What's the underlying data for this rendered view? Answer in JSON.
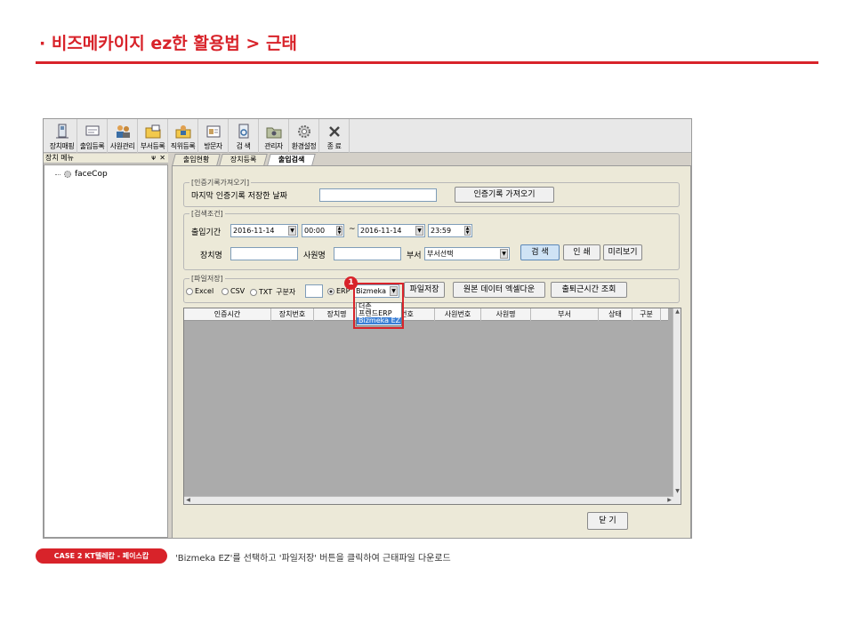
{
  "header": {
    "title": "· 비즈메카이지 ez한 활용법 > 근태"
  },
  "colors": {
    "accent": "#d8232a",
    "selection": "#3a7fd6"
  },
  "toolbar": {
    "items": [
      {
        "label": "장치매핑",
        "icon": "device-icon"
      },
      {
        "label": "출입등록",
        "icon": "entry-icon"
      },
      {
        "label": "사원관리",
        "icon": "users-icon"
      },
      {
        "label": "부서등록",
        "icon": "folder-icon"
      },
      {
        "label": "직위등록",
        "icon": "position-icon"
      },
      {
        "label": "방문자",
        "icon": "visitor-icon"
      },
      {
        "label": "검 색",
        "icon": "search-icon"
      },
      {
        "label": "관리자",
        "icon": "admin-icon"
      },
      {
        "label": "환경설정",
        "icon": "gear-icon"
      },
      {
        "label": "종 료",
        "icon": "close-icon"
      }
    ]
  },
  "sidebar": {
    "title": "장치 메뉴",
    "pin": "ᴪ",
    "close": "✕",
    "tree_item": "faceCop"
  },
  "tabs": [
    "출입현황",
    "장치등록",
    "출입검색"
  ],
  "auth_group": {
    "title": "[인증기록가져오기]",
    "last_saved_label": "마지막 인증기록 저장한 날짜",
    "last_saved_value": "",
    "fetch_button": "인증기록 가져오기"
  },
  "search_group": {
    "title": "[검색조건]",
    "period_label": "출입기간",
    "date_from": "2016-11-14",
    "time_from": "00:00",
    "tilde": "~",
    "date_to": "2016-11-14",
    "time_to": "23:59",
    "device_label": "장치명",
    "device_value": "",
    "employee_label": "사원명",
    "employee_value": "",
    "dept_label": "부서",
    "dept_value": "부서선택",
    "search_button": "검 색",
    "print_button": "인 쇄",
    "preview_button": "미리보기"
  },
  "file_group": {
    "title": "[파일저장]",
    "radio_excel": "Excel",
    "radio_csv": "CSV",
    "radio_txt": "TXT",
    "separator_label": "구분자",
    "radio_erp": "ERP",
    "erp_select_value": "Bizmeka",
    "save_button": "파일저장",
    "export_raw_button": "원본 데이터 엑셀다운",
    "attendance_button": "출퇴근시간 조회",
    "dropdown_options": [
      "더존",
      "프렌드ERP",
      "Bizmeka EZ"
    ],
    "badge_number": "1"
  },
  "grid": {
    "columns": [
      "인증시간",
      "장치번호",
      "장치명",
      "사용자번호",
      "사원번호",
      "사원명",
      "부서",
      "상태",
      "구분"
    ]
  },
  "footer": {
    "close_button": "닫 기"
  },
  "case_badge": "CASE 2  KT텔레캅 -  페이스캅",
  "caption": "'Bizmeka EZ'를 선택하고 '파일저장' 버튼을 클릭하여 근태파일 다운로드"
}
